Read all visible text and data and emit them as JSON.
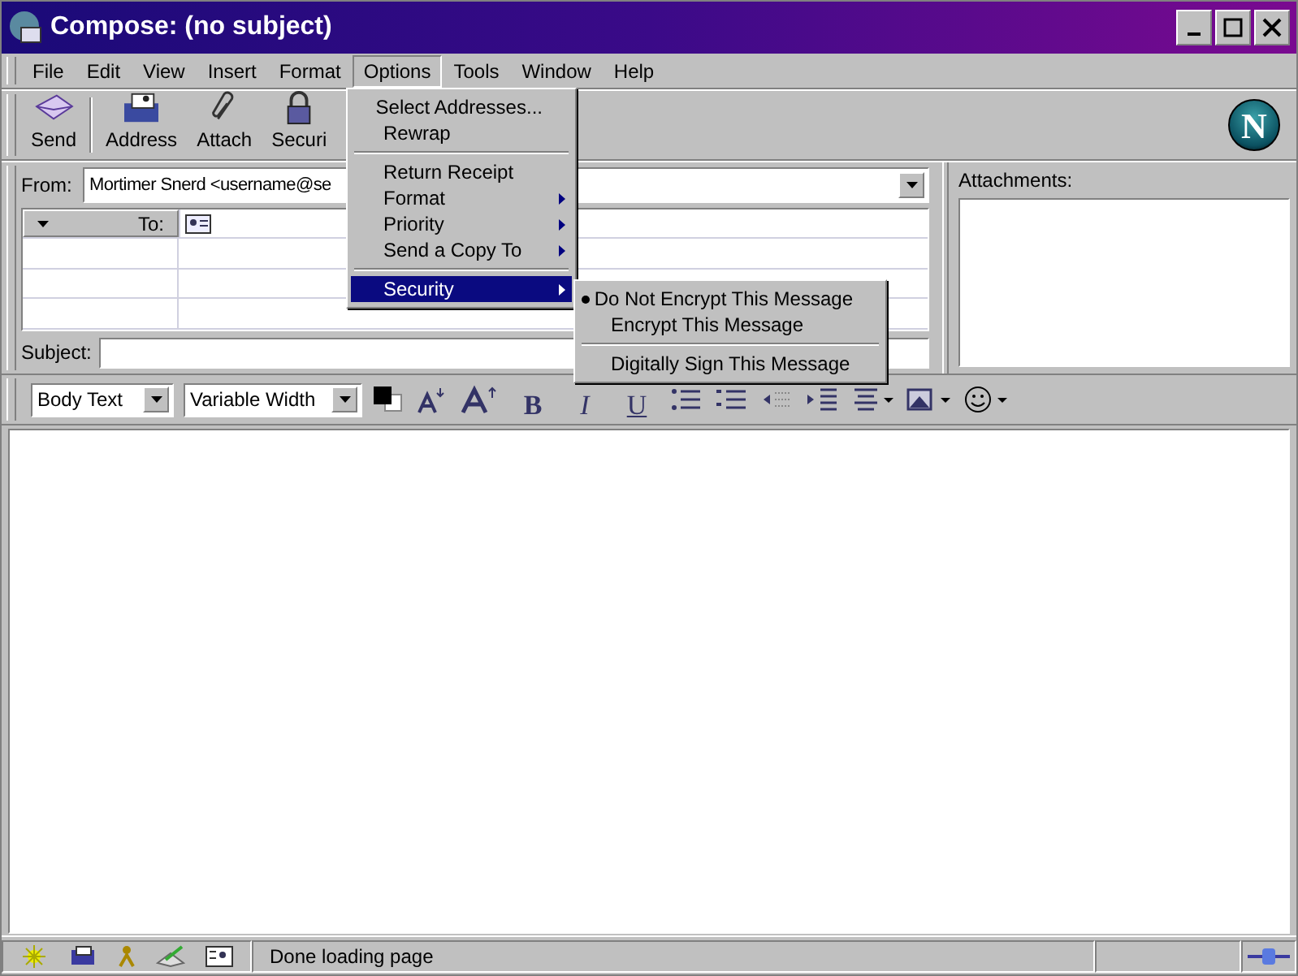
{
  "window": {
    "title": "Compose: (no subject)"
  },
  "menu_bar": [
    {
      "label": "File",
      "selected": false
    },
    {
      "label": "Edit",
      "selected": false
    },
    {
      "label": "View",
      "selected": false
    },
    {
      "label": "Insert",
      "selected": false
    },
    {
      "label": "Format",
      "selected": false
    },
    {
      "label": "Options",
      "selected": true
    },
    {
      "label": "Tools",
      "selected": false
    },
    {
      "label": "Window",
      "selected": false
    },
    {
      "label": "Help",
      "selected": false
    }
  ],
  "toolbar": [
    {
      "label": "Send",
      "kind": "send"
    },
    {
      "label": "Address",
      "kind": "address"
    },
    {
      "label": "Attach",
      "kind": "attach"
    },
    {
      "label": "Securi",
      "kind": "security"
    }
  ],
  "logo": "N",
  "header": {
    "from_label": "From:",
    "from_value": "Mortimer Snerd <username@se",
    "to_label": "To:",
    "subject_label": "Subject:",
    "attachments_label": "Attachments:"
  },
  "format_bar": {
    "paragraph_style": "Body Text",
    "font": "Variable Width",
    "styles": [
      "B",
      "I",
      "U"
    ]
  },
  "options_menu": [
    {
      "kind": "item",
      "label": "Select Addresses...",
      "selected": false
    },
    {
      "kind": "item",
      "label": "Rewrap",
      "selected": false
    },
    {
      "kind": "separator"
    },
    {
      "kind": "item",
      "label": "Return Receipt",
      "selected": false
    },
    {
      "kind": "submenu",
      "label": "Format",
      "selected": false
    },
    {
      "kind": "submenu",
      "label": "Priority",
      "selected": false
    },
    {
      "kind": "submenu",
      "label": "Send a Copy To",
      "selected": false
    },
    {
      "kind": "separator"
    },
    {
      "kind": "submenu",
      "label": "Security",
      "selected": true
    }
  ],
  "security_menu": [
    {
      "kind": "item",
      "label": "Do Not Encrypt This Message",
      "checked": true
    },
    {
      "kind": "item",
      "label": "Encrypt This Message",
      "checked": false
    },
    {
      "kind": "separator"
    },
    {
      "kind": "item",
      "label": "Digitally Sign This Message",
      "checked": false
    }
  ],
  "status_bar": {
    "text": "Done loading page"
  }
}
